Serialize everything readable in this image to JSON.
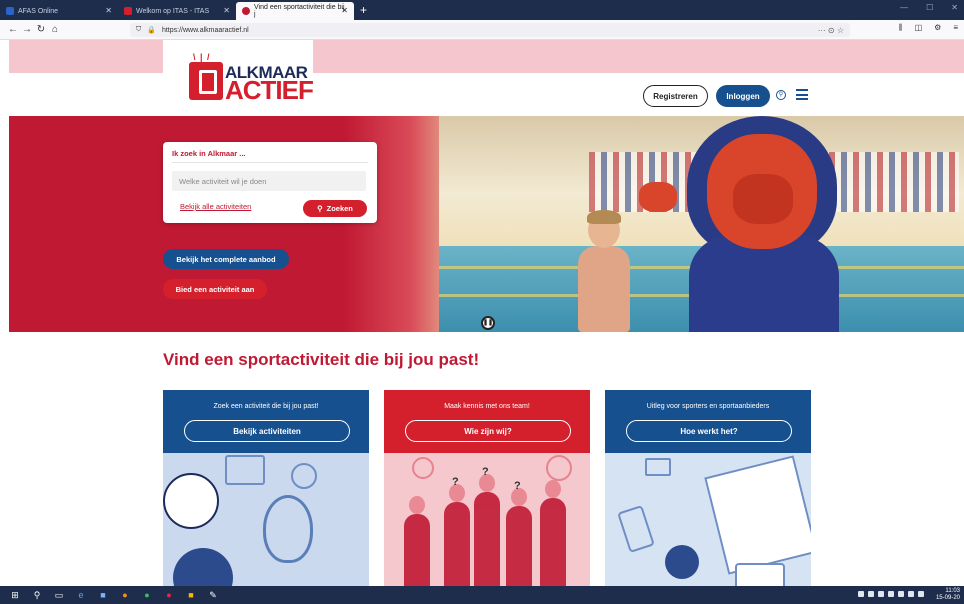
{
  "browser": {
    "tabs": [
      {
        "label": "AFAS Online",
        "color": "#2b63c6"
      },
      {
        "label": "Welkom op ITAS - ITAS",
        "color": "#d4202c"
      },
      {
        "label": "Vind een sportactiviteit die bij j",
        "color": "#c01933",
        "active": true
      }
    ],
    "new_tab": "+",
    "url": "https://www.alkmaaractief.nl",
    "url_right": "··· ⊙ ☆"
  },
  "site": {
    "logo_line1": "ALKMAAR",
    "logo_line2": "ACTIEF",
    "register_label": "Registreren",
    "login_label": "Inloggen",
    "search": {
      "title": "Ik zoek in Alkmaar ...",
      "placeholder": "Welke activiteit wil je doen",
      "all_link": "Bekijk alle activiteiten",
      "button": "Zoeken"
    },
    "offer_button": "Bekijk het complete aanbod",
    "provide_button": "Bied een activiteit aan",
    "headline": "Vind een sportactiviteit die bij jou past!",
    "cards": [
      {
        "caption": "Zoek een activiteit die bij jou past!",
        "button": "Bekijk activiteiten"
      },
      {
        "caption": "Maak kennis met ons team!",
        "button": "Wie zijn wij?"
      },
      {
        "caption": "Uitleg voor sporters en sportaanbieders",
        "button": "Hoe werkt het?"
      }
    ]
  },
  "taskbar": {
    "time": "11:03",
    "date": "15-09-20"
  },
  "colors": {
    "brand_red": "#d4202c",
    "brand_blue": "#16508f",
    "pink_band": "#f5c6cd"
  }
}
